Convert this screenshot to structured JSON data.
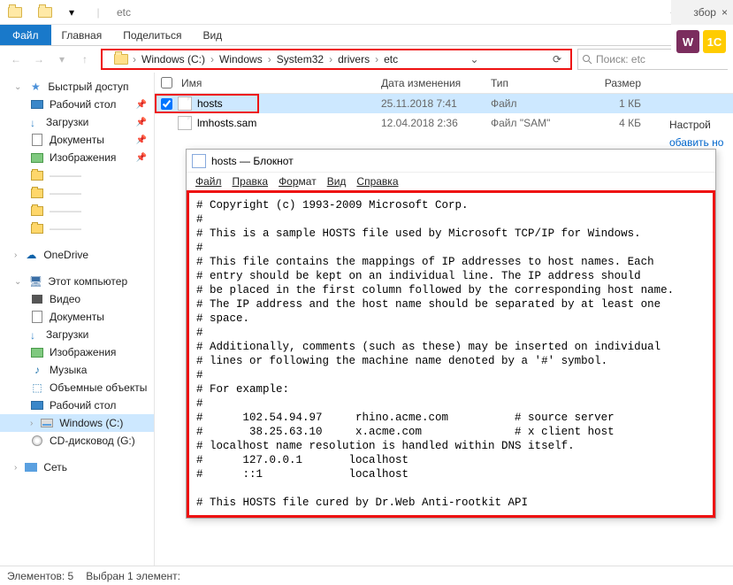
{
  "titlebar": {
    "title": "etc"
  },
  "browsertab": {
    "label": "збор",
    "close": "×"
  },
  "ribbon": {
    "file": "Файл",
    "tabs": [
      "Главная",
      "Поделиться",
      "Вид"
    ]
  },
  "rightapps": {
    "w": "W",
    "onec": "1C"
  },
  "breadcrumb": {
    "items": [
      "Windows (C:)",
      "Windows",
      "System32",
      "drivers",
      "etc"
    ]
  },
  "search": {
    "placeholder": "Поиск: etc"
  },
  "nav": {
    "quick": "Быстрый доступ",
    "quick_items": [
      {
        "label": "Рабочий стол",
        "icon": "desktop"
      },
      {
        "label": "Загрузки",
        "icon": "down"
      },
      {
        "label": "Документы",
        "icon": "doc"
      },
      {
        "label": "Изображения",
        "icon": "pic"
      }
    ],
    "onedrive": "OneDrive",
    "thispc": "Этот компьютер",
    "pc_items": [
      {
        "label": "Видео",
        "icon": "vid"
      },
      {
        "label": "Документы",
        "icon": "doc"
      },
      {
        "label": "Загрузки",
        "icon": "down"
      },
      {
        "label": "Изображения",
        "icon": "pic"
      },
      {
        "label": "Музыка",
        "icon": "music"
      },
      {
        "label": "Объемные объекты",
        "icon": "cube"
      },
      {
        "label": "Рабочий стол",
        "icon": "desktop"
      },
      {
        "label": "Windows (C:)",
        "icon": "drive",
        "sel": true
      },
      {
        "label": "CD-дисковод (G:)",
        "icon": "cd"
      }
    ],
    "network": "Сеть"
  },
  "columns": {
    "name": "Имя",
    "date": "Дата изменения",
    "type": "Тип",
    "size": "Размер"
  },
  "files": [
    {
      "name": "hosts",
      "date": "25.11.2018 7:41",
      "type": "Файл",
      "size": "1 КБ",
      "checked": true,
      "sel": true
    },
    {
      "name": "lmhosts.sam",
      "date": "12.04.2018 2:36",
      "type": "Файл \"SAM\"",
      "size": "4 КБ",
      "checked": false,
      "sel": false
    }
  ],
  "behind": {
    "settings": "Настрой",
    "add": "обавить но"
  },
  "notepad": {
    "title": "hosts — Блокнот",
    "menu": [
      "Файл",
      "Правка",
      "Формат",
      "Вид",
      "Справка"
    ],
    "body": "# Copyright (c) 1993-2009 Microsoft Corp.\n#\n# This is a sample HOSTS file used by Microsoft TCP/IP for Windows.\n#\n# This file contains the mappings of IP addresses to host names. Each\n# entry should be kept on an individual line. The IP address should\n# be placed in the first column followed by the corresponding host name.\n# The IP address and the host name should be separated by at least one\n# space.\n#\n# Additionally, comments (such as these) may be inserted on individual\n# lines or following the machine name denoted by a '#' symbol.\n#\n# For example:\n#\n#      102.54.94.97     rhino.acme.com          # source server\n#       38.25.63.10     x.acme.com              # x client host\n# localhost name resolution is handled within DNS itself.\n#      127.0.0.1       localhost\n#      ::1             localhost\n\n# This HOSTS file cured by Dr.Web Anti-rootkit API"
  },
  "status": {
    "count": "Элементов: 5",
    "selected": "Выбран 1 элемент:"
  }
}
